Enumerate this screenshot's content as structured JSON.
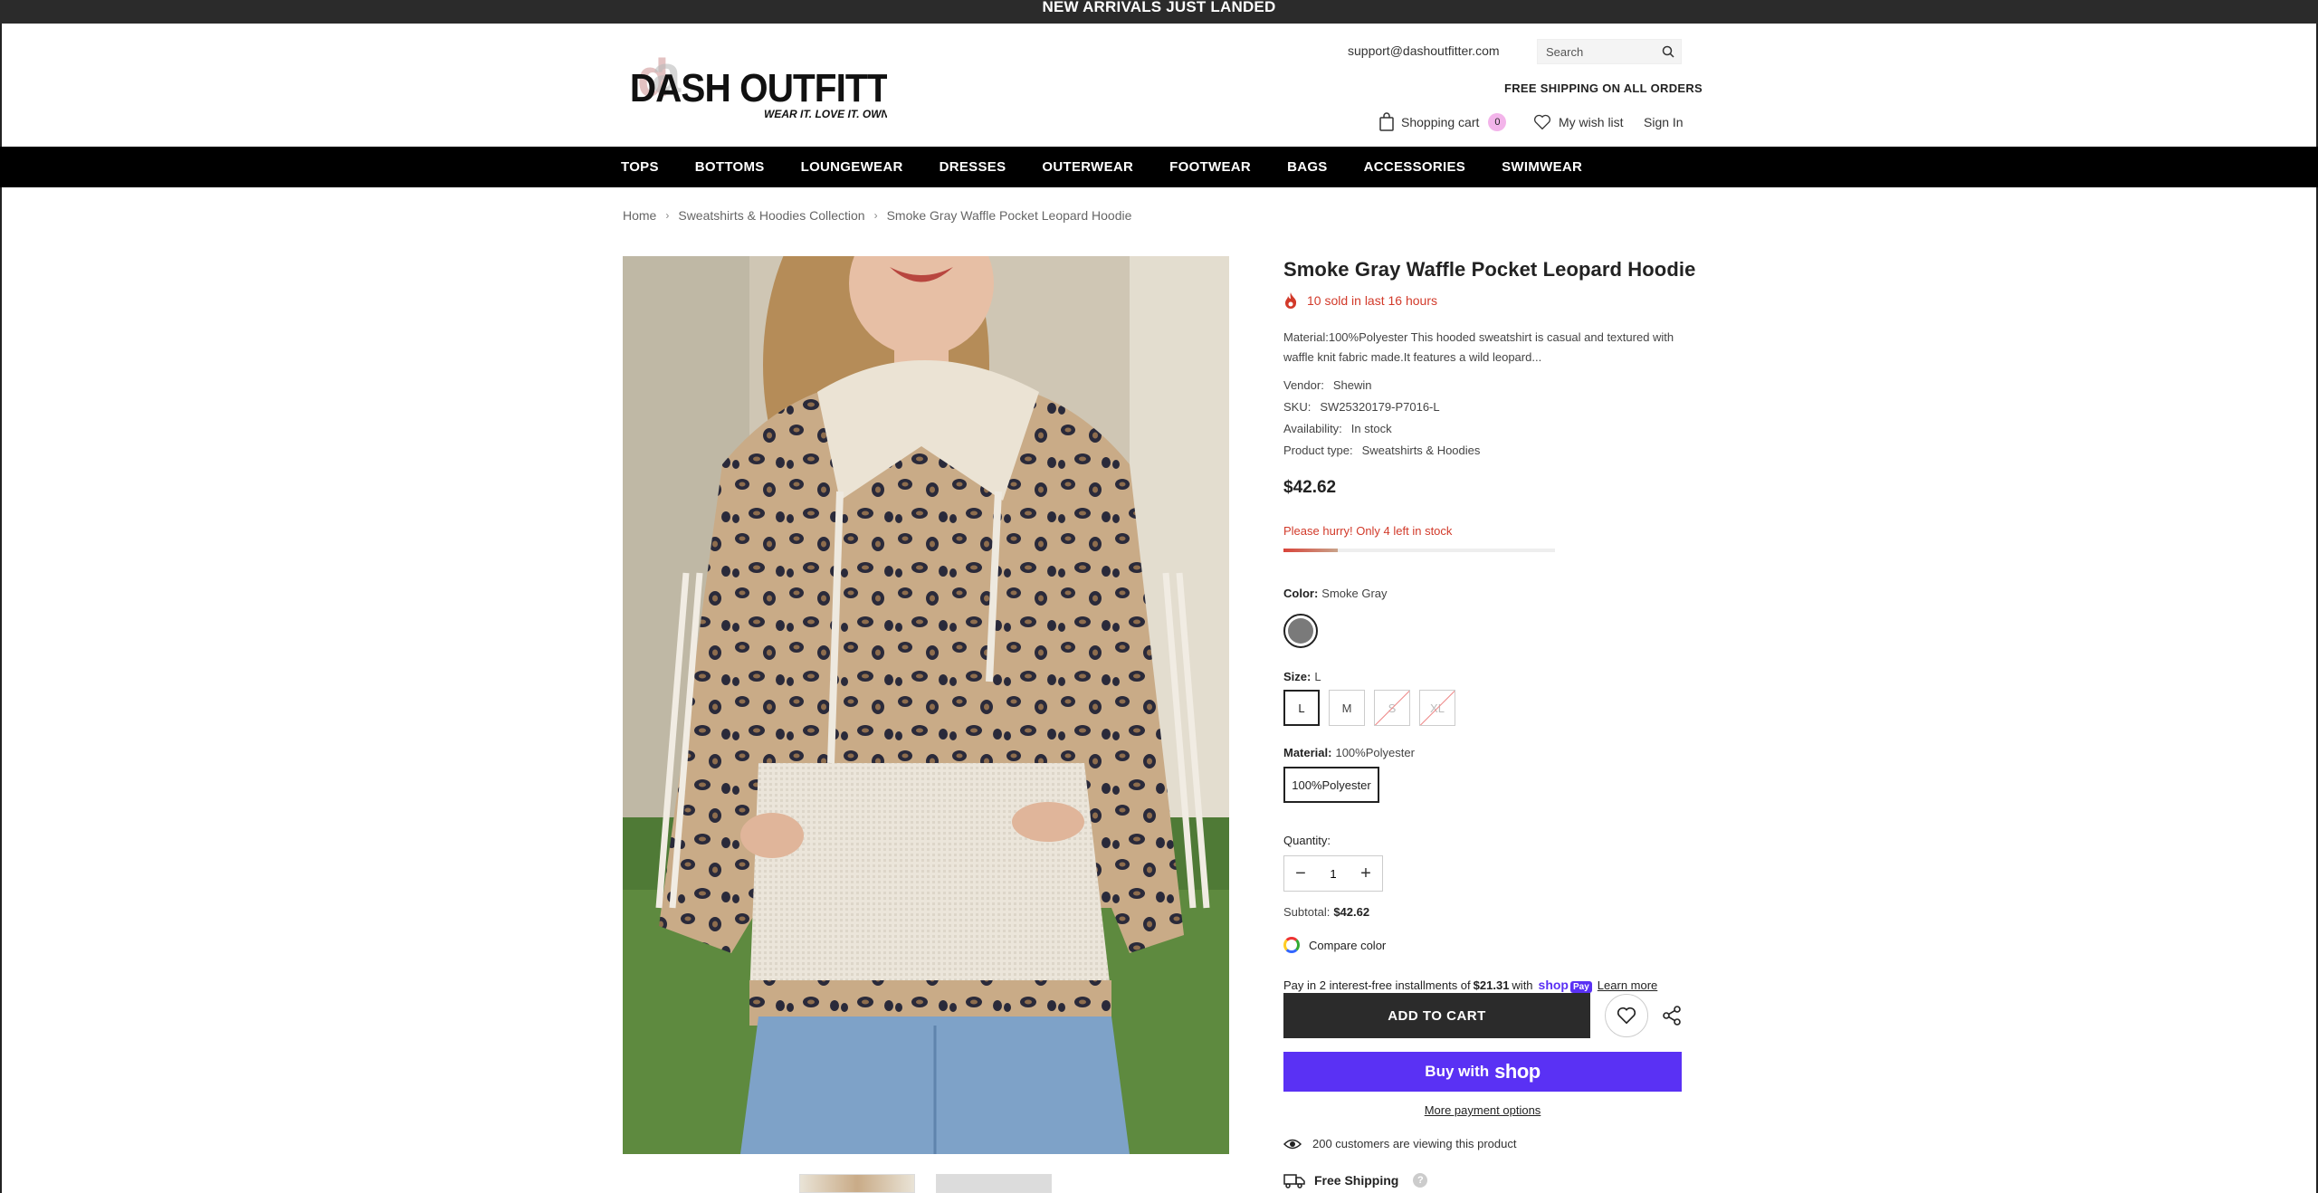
{
  "announcement": "NEW ARRIVALS JUST LANDED",
  "header": {
    "logo_text": "DASH OUTFITTERS",
    "logo_tagline": "WEAR IT. LOVE IT. OWN IT.",
    "support_email": "support@dashoutfitter.com",
    "search_placeholder": "Search",
    "free_shipping": "FREE SHIPPING ON ALL ORDERS",
    "cart_label": "Shopping cart",
    "cart_count": "0",
    "wishlist_label": "My wish list",
    "signin_label": "Sign In"
  },
  "nav": {
    "items": [
      "TOPS",
      "BOTTOMS",
      "LOUNGEWEAR",
      "DRESSES",
      "OUTERWEAR",
      "FOOTWEAR",
      "BAGS",
      "ACCESSORIES",
      "SWIMWEAR"
    ]
  },
  "breadcrumb": [
    "Home",
    "Sweatshirts & Hoodies Collection",
    "Smoke Gray Waffle Pocket Leopard Hoodie"
  ],
  "product": {
    "title": "Smoke Gray Waffle Pocket Leopard Hoodie",
    "sold_text": "10 sold in last 16 hours",
    "description": "Material:100%Polyester This hooded sweatshirt is casual and textured with waffle knit fabric made.It features a wild leopard...",
    "vendor_label": "Vendor:",
    "vendor": "Shewin",
    "sku_label": "SKU:",
    "sku": "SW25320179-P7016-L",
    "availability_label": "Availability:",
    "availability": "In stock",
    "type_label": "Product type:",
    "type": "Sweatshirts & Hoodies",
    "price": "$42.62",
    "hurry_text": "Please hurry! Only 4 left in stock",
    "stock_level_fraction": 0.2,
    "color_label": "Color:",
    "color_value": "Smoke Gray",
    "swatch_color": "#7a7a7a",
    "size_label": "Size:",
    "size_value": "L",
    "sizes": [
      "L",
      "M",
      "S",
      "XL"
    ],
    "material_label": "Material:",
    "material_value": "100%Polyester",
    "material_option": "100%Polyester",
    "quantity_label": "Quantity:",
    "quantity": "1",
    "subtotal_label": "Subtotal:",
    "subtotal": "$42.62",
    "compare_color": "Compare color",
    "installments_prefix": "Pay in 2 interest-free installments of",
    "installment_amount": "$21.31",
    "installments_with": "with",
    "shop_pay_brand": "shop",
    "shop_pay_badge": "Pay",
    "learn_more": "Learn more",
    "add_to_cart": "ADD TO CART",
    "buy_with": "Buy with",
    "buy_with_brand": "shop",
    "more_payment": "More payment options",
    "viewing_text": "200 customers are viewing this product",
    "free_shipping_row": "Free Shipping",
    "help_mark": "?"
  },
  "colors": {
    "accent_red": "#d23a2a",
    "shop_pay_purple": "#5a31f4",
    "nav_bg": "#000000"
  }
}
